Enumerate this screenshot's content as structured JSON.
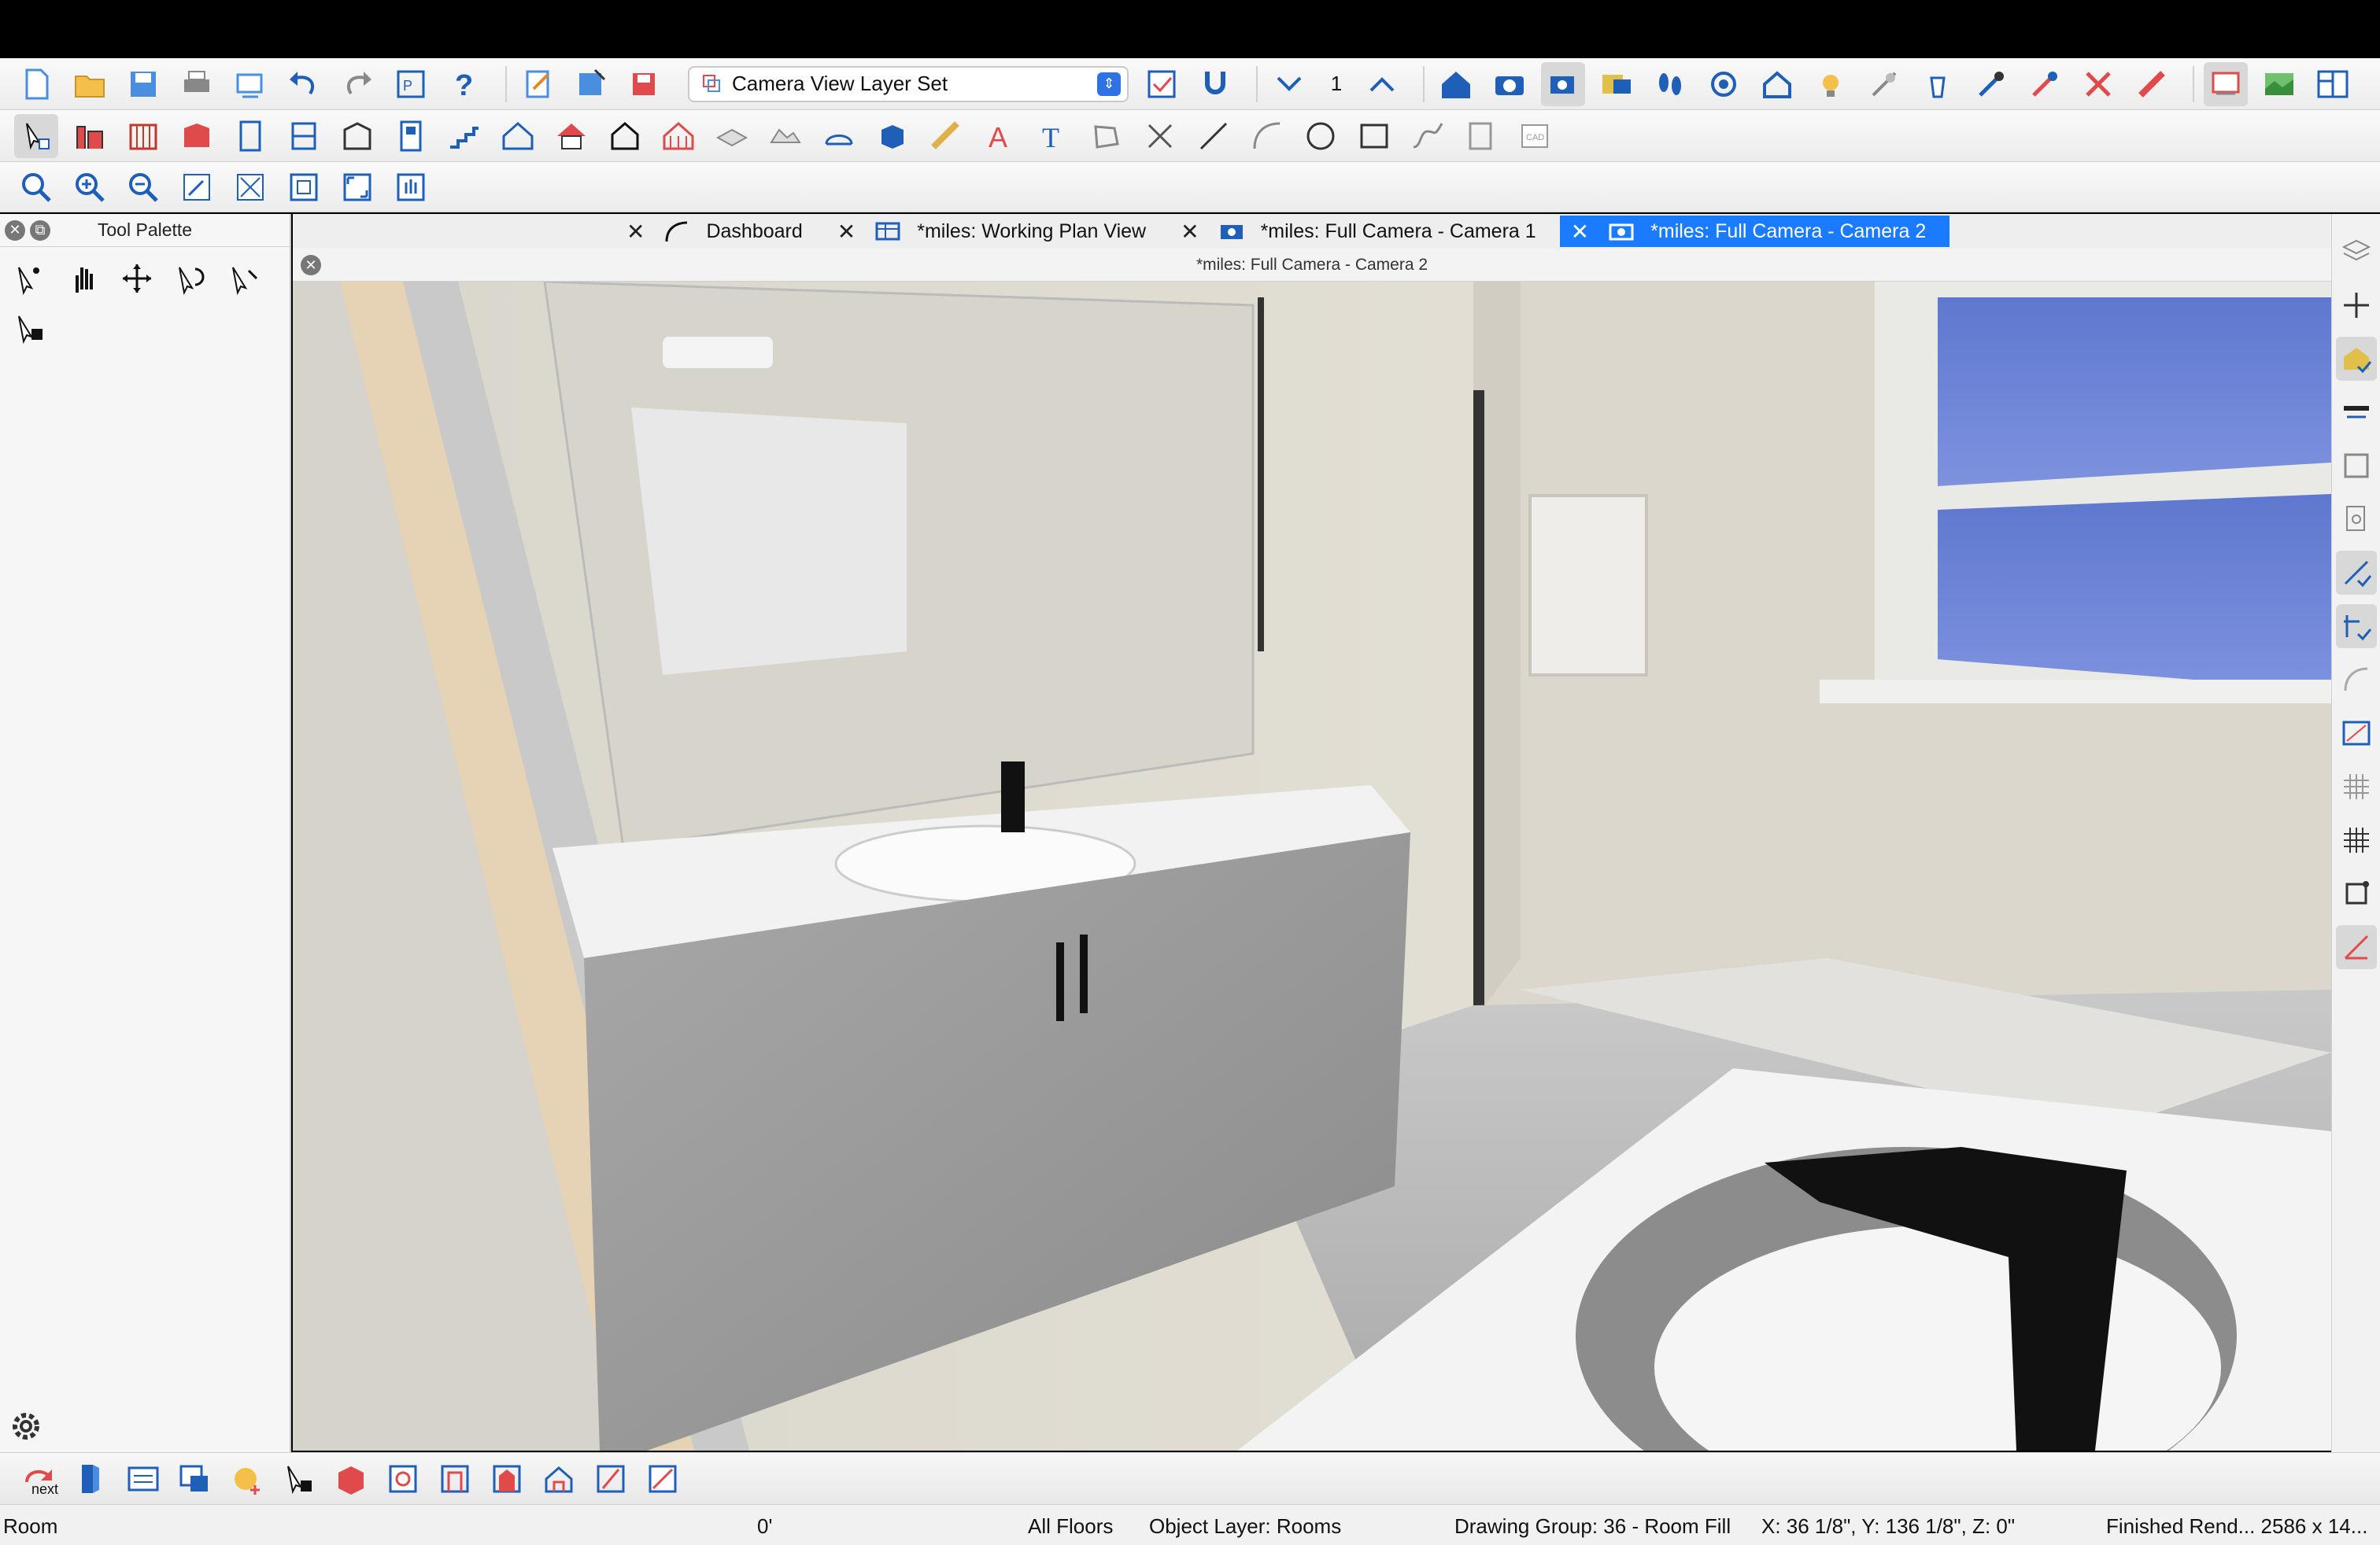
{
  "toolbar1": {
    "layer_set_select": "Camera View Layer Set",
    "floor_number": "1",
    "icons": [
      "new-file-icon",
      "open-folder-icon",
      "save-icon",
      "print-icon",
      "print-preview-icon",
      "undo-icon",
      "redo-icon",
      "plan-options-icon",
      "help-icon",
      "edit-note-icon",
      "save-as-icon",
      "export-icon"
    ]
  },
  "palette": {
    "title": "Tool Palette"
  },
  "tabs": [
    {
      "label": "Dashboard",
      "icon": "dashboard-icon"
    },
    {
      "label": "*miles:  Working Plan View",
      "icon": "plan-view-icon"
    },
    {
      "label": "*miles: Full Camera - Camera 1",
      "icon": "camera-icon"
    },
    {
      "label": "*miles: Full Camera - Camera 2",
      "icon": "camera-icon",
      "active": true
    }
  ],
  "view_title": "*miles: Full Camera - Camera 2",
  "bottombar": {
    "next_label": "next"
  },
  "status": {
    "object_type": "Room",
    "elevation": "0'",
    "floors": "All Floors",
    "object_layer": "Object Layer: Rooms",
    "drawing_group": "Drawing Group: 36 - Room Fill",
    "coordinates": "X: 36 1/8\", Y: 136 1/8\", Z: 0\"",
    "render_status": "Finished Rend...  2586 x 14..."
  },
  "colors": {
    "accent": "#1a7bff",
    "wall": "#e3ddd0",
    "vanity": "#9b9b9b",
    "countertop": "#f2f2f2",
    "sky": "#6f87d6",
    "floor_tile": "#b9b9b9"
  }
}
